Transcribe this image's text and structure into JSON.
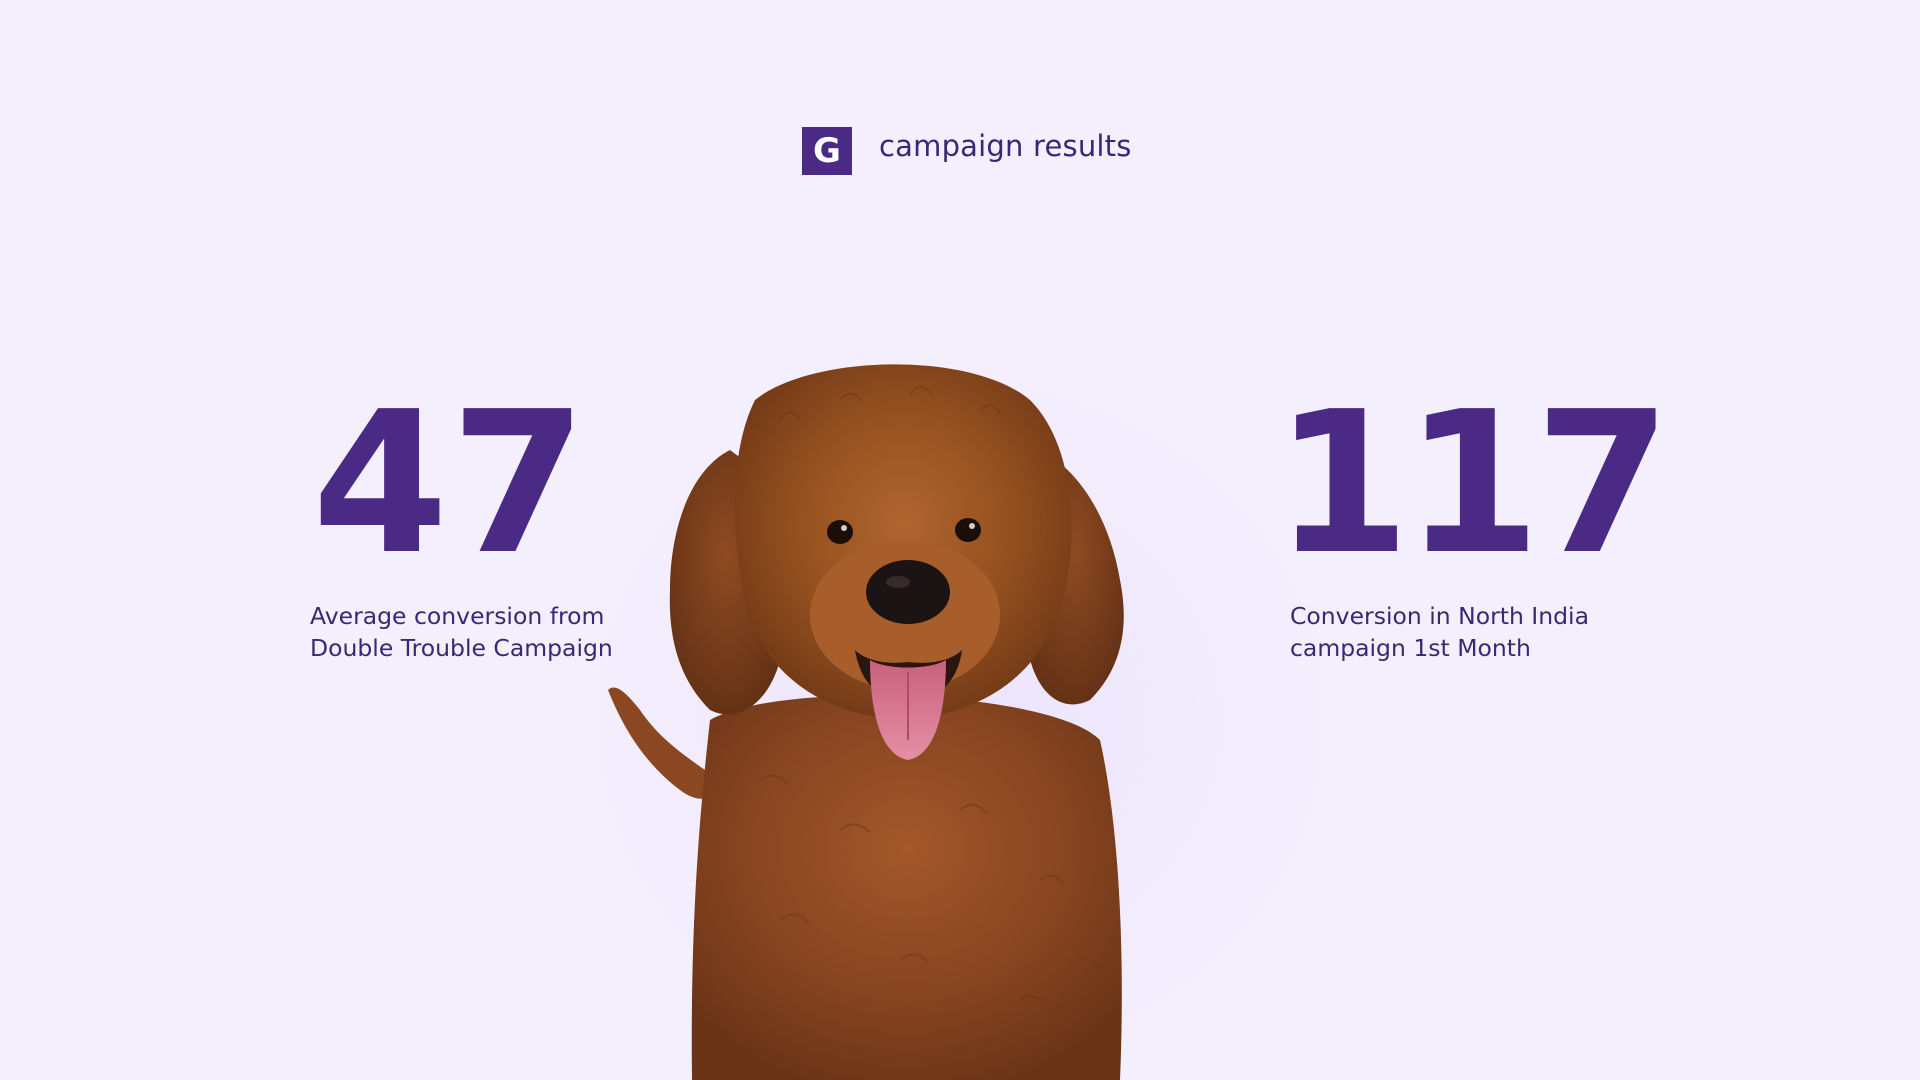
{
  "header": {
    "logo_letter": "G",
    "title": "campaign results"
  },
  "stats": [
    {
      "value": "47",
      "caption_line1": "Average conversion from",
      "caption_line2": "Double Trouble Campaign"
    },
    {
      "value": "117",
      "caption_line1": "Conversion in North India",
      "caption_line2": "campaign 1st Month"
    }
  ],
  "image": {
    "subject": "dog"
  },
  "colors": {
    "background": "#f4effd",
    "accent": "#4a2a85",
    "text": "#3d2673",
    "fur": "#8a4a22"
  }
}
